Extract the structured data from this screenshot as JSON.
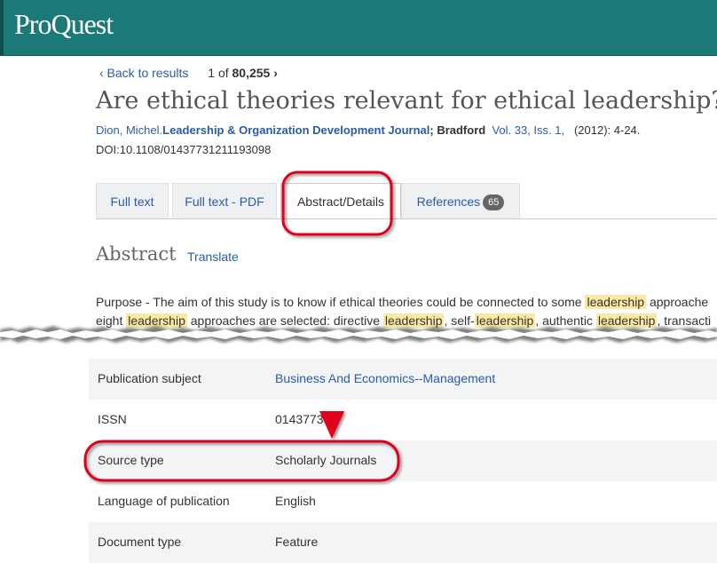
{
  "header": {
    "logo": "ProQuest"
  },
  "nav": {
    "back": "‹ Back to results",
    "position": "1 of ",
    "total": "80,255",
    "next": "›"
  },
  "article": {
    "title": "Are ethical theories relevant for ethical leadership?",
    "author": "Dion, Michel.",
    "journal": "Leadership & Organization Development Journal",
    "place": "; Bradford",
    "volume": "Vol. 33, Iss. 1,",
    "date_pages": "(2012): 4-24.",
    "doi": "DOI:10.1108/01437731211193098"
  },
  "tabs": {
    "full_text": "Full text",
    "full_text_pdf": "Full text - PDF",
    "abstract_details": "Abstract/Details",
    "references": "References",
    "references_count": "65"
  },
  "abstract": {
    "heading": "Abstract",
    "translate": "Translate",
    "line1_a": "Purpose - The aim of this study is to know if ethical theories could be connected to some ",
    "line1_hl": "leadership",
    "line1_b": " approache",
    "line2_a": "eight ",
    "line2_hl1": "leadership",
    "line2_b": " approaches are selected: directive ",
    "line2_hl2": "leadership",
    "line2_c": ", self-",
    "line2_hl3": "leadership",
    "line2_d": ", authentic ",
    "line2_hl4": "leadership",
    "line2_e": ", transacti"
  },
  "details": [
    {
      "label": "Publication subject",
      "value": "Business And Economics--Management"
    },
    {
      "label": "ISSN",
      "value": "01437739"
    },
    {
      "label": "Source type",
      "value": "Scholarly Journals"
    },
    {
      "label": "Language of publication",
      "value": "English"
    },
    {
      "label": "Document type",
      "value": "Feature"
    }
  ],
  "colors": {
    "header": "#1b7a78",
    "link": "#2a5ca8",
    "highlight": "#fbe9a3",
    "annotation": "#e0001a"
  }
}
